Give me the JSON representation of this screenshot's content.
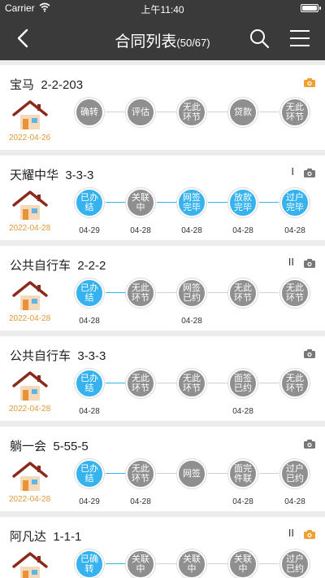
{
  "status_bar": {
    "carrier": "Carrier",
    "time": "上午11:40"
  },
  "nav": {
    "title": "合同列表",
    "count": "(50/67)"
  },
  "colors": {
    "step_done": "#36b3ee",
    "step_todo": "#8f8f8f",
    "bar": "#3a3a3a",
    "date": "#e09a3c",
    "camera_active": "#f0a030"
  },
  "contracts": [
    {
      "title": "宝马  2-2-203",
      "marks": "",
      "camera": "orange",
      "date": "2022-04-26",
      "steps": [
        {
          "label": "确转",
          "state": "todo",
          "date": ""
        },
        {
          "label": "评估",
          "state": "todo",
          "date": ""
        },
        {
          "label": "无此环节",
          "state": "todo",
          "date": ""
        },
        {
          "label": "贷款",
          "state": "todo",
          "date": ""
        },
        {
          "label": "无此环节",
          "state": "todo",
          "date": ""
        }
      ]
    },
    {
      "title": "天耀中华  3-3-3",
      "marks": "I",
      "camera": "gray",
      "date": "2022-04-28",
      "steps": [
        {
          "label": "已办结",
          "state": "done",
          "date": "04-29"
        },
        {
          "label": "关联中",
          "state": "todo",
          "date": "04-28"
        },
        {
          "label": "网签完毕",
          "state": "done",
          "date": "04-28"
        },
        {
          "label": "放款完毕",
          "state": "done",
          "date": "04-28"
        },
        {
          "label": "过户完毕",
          "state": "done",
          "date": "04-28"
        }
      ]
    },
    {
      "title": "公共自行车  2-2-2",
      "marks": "II",
      "camera": "gray",
      "date": "2022-04-28",
      "steps": [
        {
          "label": "已办结",
          "state": "done",
          "date": "04-28"
        },
        {
          "label": "无此环节",
          "state": "todo",
          "date": ""
        },
        {
          "label": "网签已约",
          "state": "todo",
          "date": "04-28"
        },
        {
          "label": "无此环节",
          "state": "todo",
          "date": ""
        },
        {
          "label": "无此环节",
          "state": "todo",
          "date": ""
        }
      ]
    },
    {
      "title": "公共自行车  3-3-3",
      "marks": "",
      "camera": "gray",
      "date": "2022-04-28",
      "steps": [
        {
          "label": "已办结",
          "state": "done",
          "date": "04-28"
        },
        {
          "label": "无此环节",
          "state": "todo",
          "date": ""
        },
        {
          "label": "无此环节",
          "state": "todo",
          "date": ""
        },
        {
          "label": "面签已约",
          "state": "todo",
          "date": "04-28"
        },
        {
          "label": "无此环节",
          "state": "todo",
          "date": ""
        }
      ]
    },
    {
      "title": "躺一会  5-55-5",
      "marks": "",
      "camera": "gray",
      "date": "2022-04-28",
      "steps": [
        {
          "label": "已办结",
          "state": "done",
          "date": "04-29"
        },
        {
          "label": "无此环节",
          "state": "todo",
          "date": "04-28"
        },
        {
          "label": "网签",
          "state": "todo",
          "date": ""
        },
        {
          "label": "面完件联",
          "state": "todo",
          "date": "04-28"
        },
        {
          "label": "过户已约",
          "state": "todo",
          "date": "04-28"
        }
      ]
    },
    {
      "title": "阿凡达  1-1-1",
      "marks": "II",
      "camera": "orange",
      "date": "",
      "steps": [
        {
          "label": "已确转",
          "state": "done",
          "date": ""
        },
        {
          "label": "关联中",
          "state": "todo",
          "date": ""
        },
        {
          "label": "关联中",
          "state": "todo",
          "date": ""
        },
        {
          "label": "关联中",
          "state": "todo",
          "date": ""
        },
        {
          "label": "过户已约",
          "state": "todo",
          "date": ""
        }
      ]
    }
  ]
}
